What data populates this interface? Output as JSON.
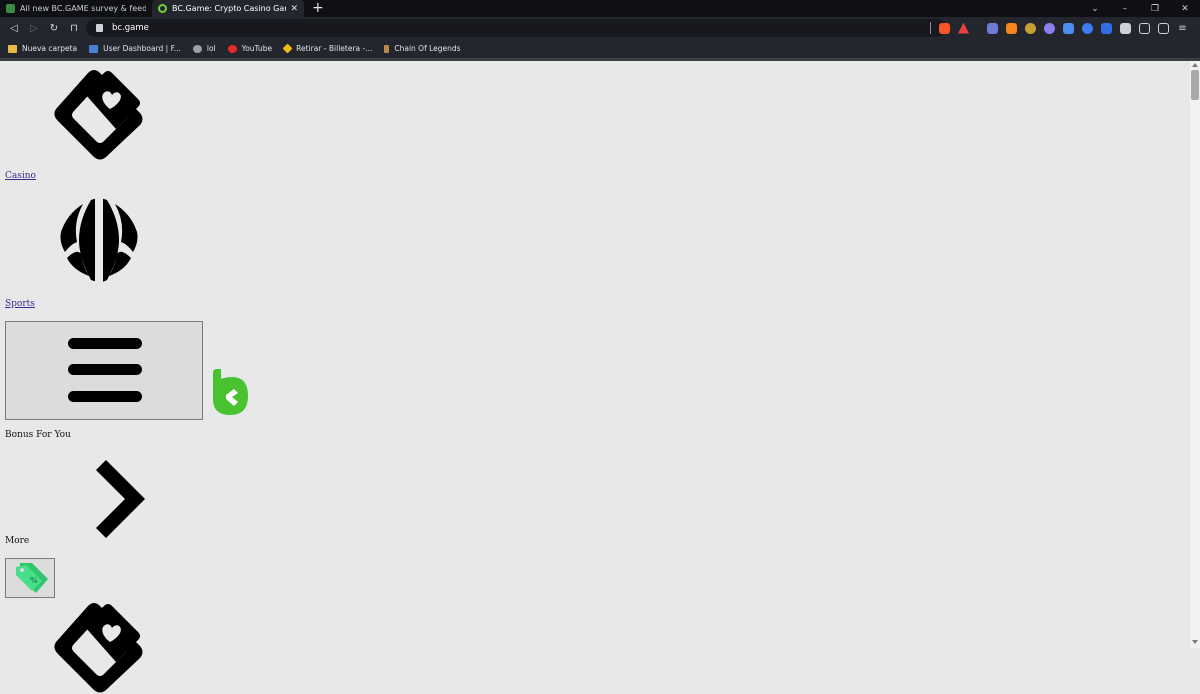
{
  "browser": {
    "tabs": [
      {
        "title": "All new BC.GAME survey & feedback re",
        "active": false
      },
      {
        "title": "BC.Game: Crypto Casino Games & Cas",
        "active": true
      }
    ],
    "new_tab_label": "+",
    "url": "bc.game",
    "bookmarks": [
      {
        "label": "Nueva carpeta",
        "icon": "folder-icon",
        "color": "#e9b949"
      },
      {
        "label": "User Dashboard | F...",
        "icon": "dashboard-icon",
        "color": "#4a7fd6"
      },
      {
        "label": "lol",
        "icon": "lol-icon",
        "color": "#9aa0aa"
      },
      {
        "label": "YouTube",
        "icon": "youtube-icon",
        "color": "#e52d27"
      },
      {
        "label": "Retirar - Billetera -...",
        "icon": "binance-icon",
        "color": "#f0b90b"
      },
      {
        "label": "Chain Of Legends",
        "icon": "chain-of-legends-icon",
        "color": "#b98a4a"
      }
    ],
    "window_controls": {
      "chevron": "⌄",
      "minimize": "–",
      "restore": "❐",
      "close": "✕"
    }
  },
  "page": {
    "casino_label": "Casino",
    "sports_label": "Sports",
    "bonus_label": "Bonus For You",
    "more_label": "More"
  },
  "colors": {
    "brand_green": "#48c22e",
    "promo_green": "#2ec76b"
  }
}
